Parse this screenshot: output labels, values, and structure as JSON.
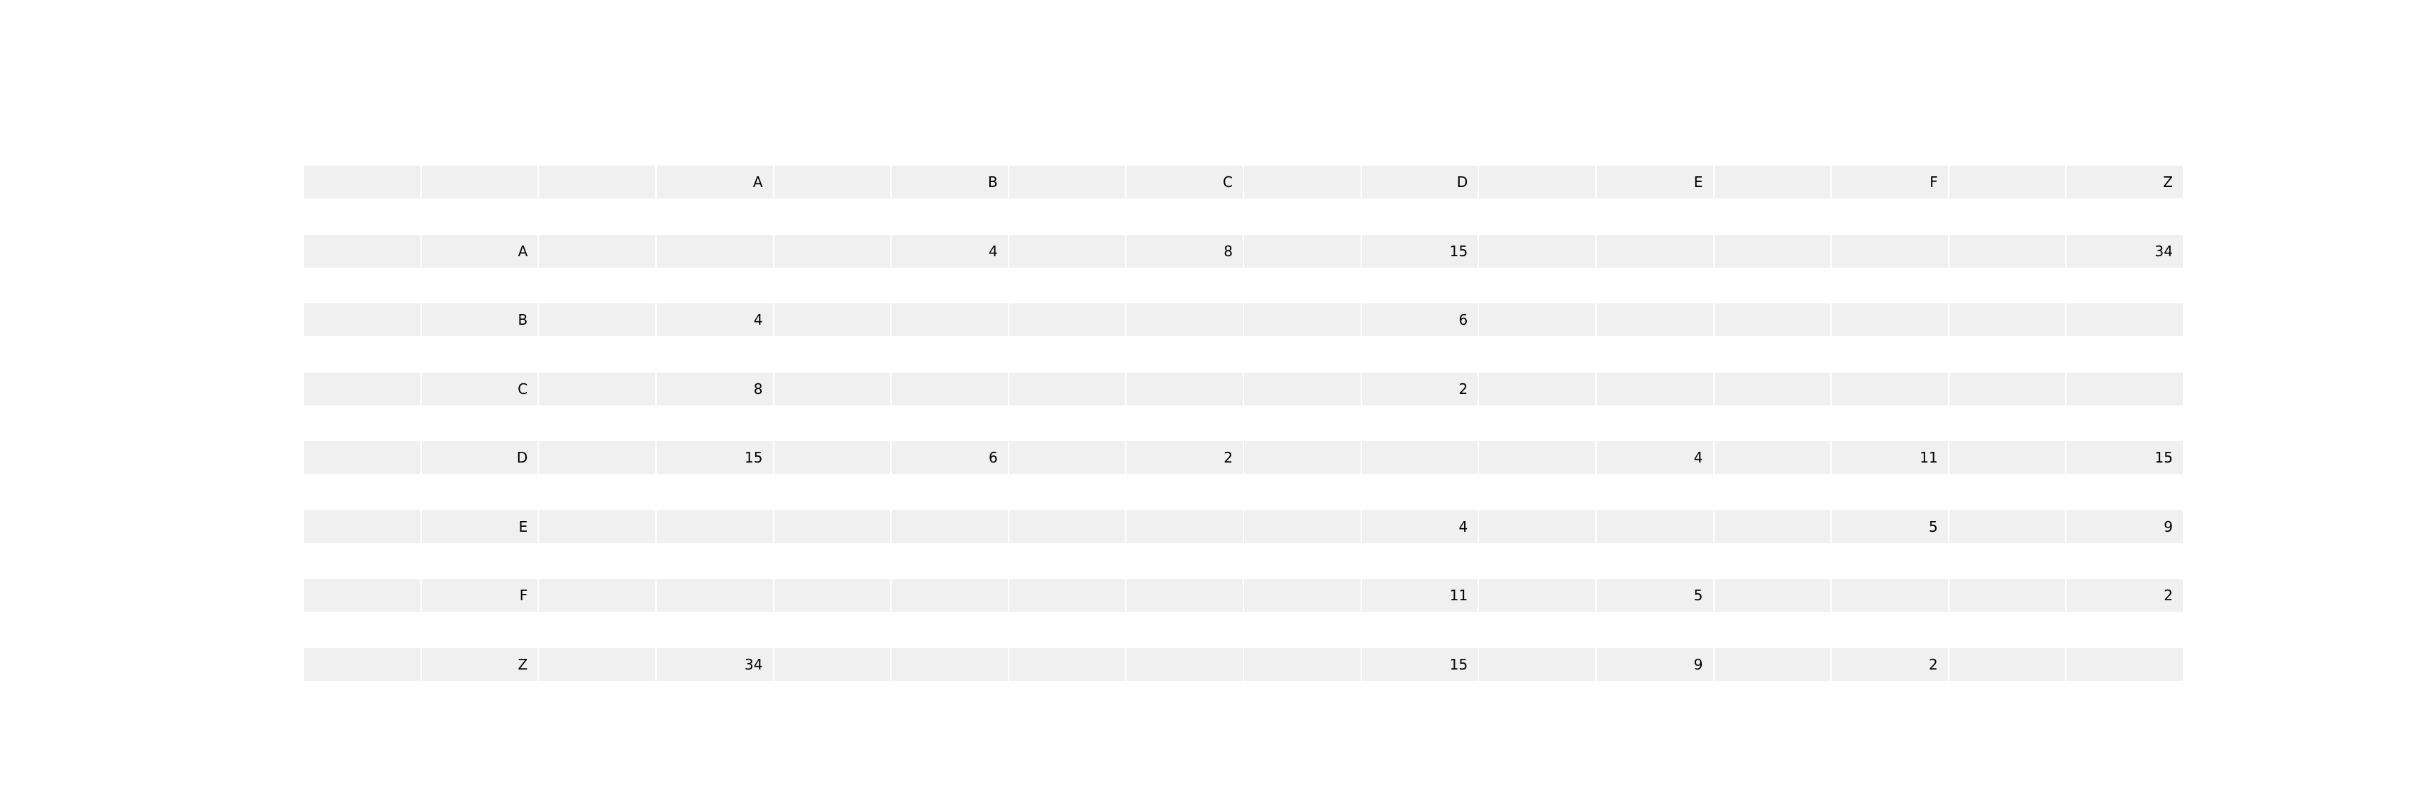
{
  "chart_data": {
    "type": "table",
    "columns": [
      "A",
      "B",
      "C",
      "D",
      "E",
      "F",
      "Z"
    ],
    "rows": [
      {
        "label": "A",
        "values": [
          "",
          "4",
          "8",
          "15",
          "",
          "",
          "34"
        ]
      },
      {
        "label": "B",
        "values": [
          "4",
          "",
          "",
          "6",
          "",
          "",
          ""
        ]
      },
      {
        "label": "C",
        "values": [
          "8",
          "",
          "",
          "2",
          "",
          "",
          ""
        ]
      },
      {
        "label": "D",
        "values": [
          "15",
          "6",
          "2",
          "",
          "4",
          "11",
          "15"
        ]
      },
      {
        "label": "E",
        "values": [
          "",
          "",
          "",
          "4",
          "",
          "5",
          "9"
        ]
      },
      {
        "label": "F",
        "values": [
          "",
          "",
          "",
          "11",
          "5",
          "",
          "2"
        ]
      },
      {
        "label": "Z",
        "values": [
          "34",
          "",
          "",
          "15",
          "9",
          "2",
          ""
        ]
      }
    ],
    "cell_color": "#f0f0f0",
    "grid_line_color": "#ffffff"
  }
}
